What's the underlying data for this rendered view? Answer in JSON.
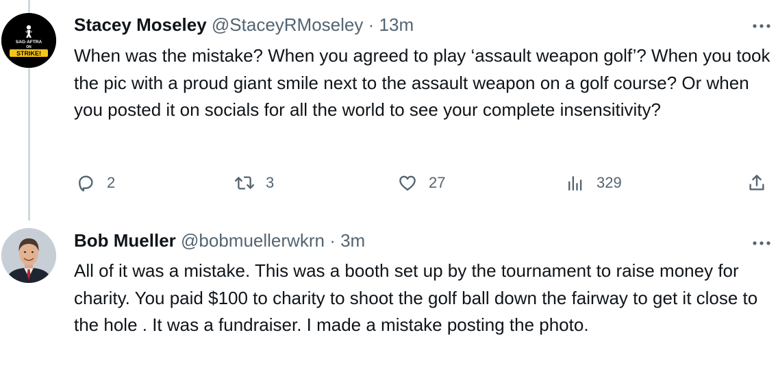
{
  "tweets": [
    {
      "name": "Stacey Moseley",
      "handle": "@StaceyRMoseley",
      "separator": "·",
      "time": "13m",
      "avatar_text": [
        "SAG·AFTRA",
        "ON",
        "STRIKE!"
      ],
      "text": "When was the mistake? When you agreed to play ‘assault weapon golf’? When you took the pic with a proud giant smile next to the assault weapon on a golf course? Or when you posted it on socials for all the world to see your complete insensitivity?",
      "replies": "2",
      "retweets": "3",
      "likes": "27",
      "views": "329"
    },
    {
      "name": "Bob Mueller",
      "handle": "@bobmuellerwkrn",
      "separator": "·",
      "time": "3m",
      "text": "All of it was a mistake. This was a booth set up by the tournament to raise money for charity. You paid $100 to charity to shoot the golf ball down the fairway to get it close to the hole . It was a fundraiser.  I made a mistake posting the photo."
    }
  ],
  "icons": {
    "reply": "reply-icon",
    "retweet": "retweet-icon",
    "like": "heart-icon",
    "views": "views-icon",
    "share": "share-icon",
    "more": "more-icon"
  },
  "colors": {
    "text": "#0f1419",
    "secondary": "#536471",
    "thread_line": "#cfd9de",
    "strike_yellow": "#f5c518"
  }
}
